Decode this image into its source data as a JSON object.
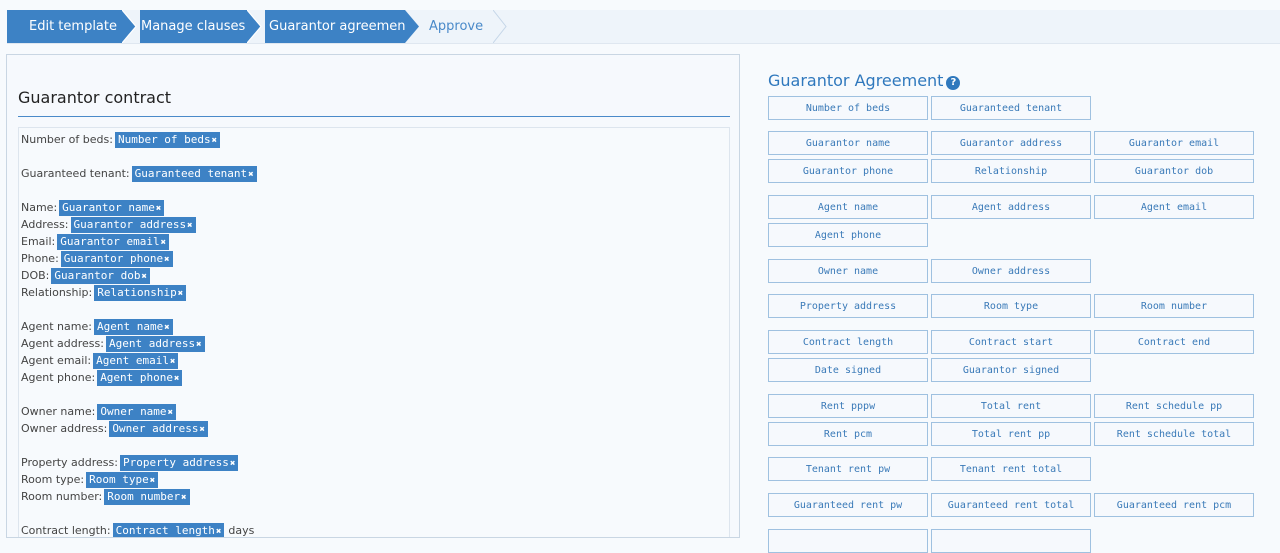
{
  "wizard": {
    "steps": [
      "Edit template",
      "Manage clauses",
      "Guarantor agreement",
      "Approve"
    ]
  },
  "left": {
    "title": "Guarantor contract",
    "lines": [
      {
        "label": "Number of beds:",
        "tag": "Number of beds"
      },
      {
        "label": "Guaranteed tenant:",
        "tag": "Guaranteed tenant"
      },
      {
        "label": "Name:",
        "tag": "Guarantor name"
      },
      {
        "label": "Address:",
        "tag": "Guarantor address"
      },
      {
        "label": "Email:",
        "tag": "Guarantor email"
      },
      {
        "label": "Phone:",
        "tag": "Guarantor phone"
      },
      {
        "label": "DOB:",
        "tag": "Guarantor dob"
      },
      {
        "label": "Relationship:",
        "tag": "Relationship"
      },
      {
        "label": "Agent name:",
        "tag": "Agent name"
      },
      {
        "label": "Agent address:",
        "tag": "Agent address"
      },
      {
        "label": "Agent email:",
        "tag": "Agent email"
      },
      {
        "label": "Agent phone:",
        "tag": "Agent phone"
      },
      {
        "label": "Owner name:",
        "tag": "Owner name"
      },
      {
        "label": "Owner address:",
        "tag": "Owner address"
      },
      {
        "label": "Property address:",
        "tag": "Property address"
      },
      {
        "label": "Room type:",
        "tag": "Room type"
      },
      {
        "label": "Room number:",
        "tag": "Room number"
      },
      {
        "label": "Contract length:",
        "tag": "Contract length",
        "after": "days"
      }
    ]
  },
  "right": {
    "title": "Guarantor Agreement",
    "help_icon": "?",
    "chips": [
      "Number of beds",
      "Guaranteed tenant",
      "Guarantor name",
      "Guarantor address",
      "Guarantor email",
      "Guarantor phone",
      "Relationship",
      "Guarantor dob",
      "Agent name",
      "Agent address",
      "Agent email",
      "Agent phone",
      "Owner name",
      "Owner address",
      "Property address",
      "Room type",
      "Room number",
      "Contract length",
      "Contract start",
      "Contract end",
      "Date signed",
      "Guarantor signed",
      "Rent pppw",
      "Total rent",
      "Rent schedule pp",
      "Rent pcm",
      "Total rent pp",
      "Rent schedule total",
      "Tenant rent pw",
      "Tenant rent total",
      "Guaranteed rent pw",
      "Guaranteed rent total",
      "Guaranteed rent pcm",
      "",
      ""
    ]
  },
  "colors": {
    "accent": "#3d82c5",
    "link": "#2f78bd",
    "chip_border": "#9fc1e0"
  }
}
